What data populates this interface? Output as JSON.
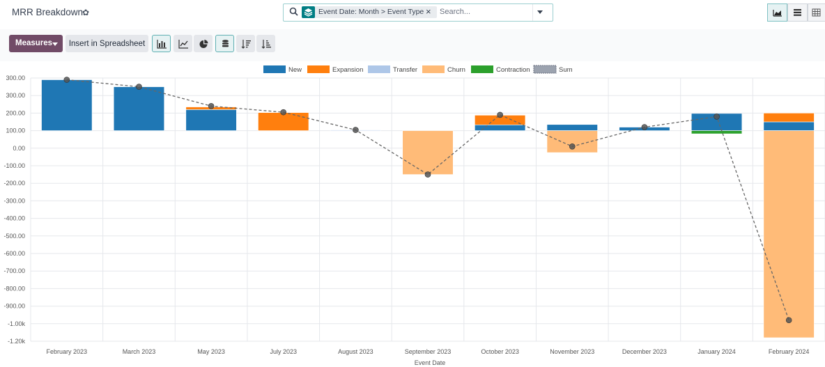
{
  "header": {
    "title": "MRR Breakdown",
    "gear_icon": "gear-icon"
  },
  "search": {
    "facet_label": "Event Date: Month > Event Type",
    "placeholder": "Search...",
    "close_glyph": "×"
  },
  "views": [
    "graph-view-icon",
    "list-view-icon",
    "pivot-view-icon"
  ],
  "controls": {
    "measures_label": "Measures",
    "insert_label": "Insert in Spreadsheet"
  },
  "colors": {
    "new": "#1f77b4",
    "expansion": "#ff7f0e",
    "transfer": "#aec7e8",
    "churn": "#ffbb78",
    "contraction": "#2ca02c",
    "sum": "#666666",
    "accent": "#714b67",
    "teal": "#017e84"
  },
  "chart_data": {
    "type": "bar",
    "stacked": true,
    "xlabel": "Event Date",
    "ylabel": "",
    "ylim": [
      -1200,
      300
    ],
    "y_ticks": [
      300,
      200,
      100,
      0,
      -100,
      -200,
      -300,
      -400,
      -500,
      -600,
      -700,
      -800,
      -900,
      -1000,
      -1100,
      -1200
    ],
    "y_tick_labels": [
      "300.00",
      "300.00",
      "200.00",
      "100.00",
      "0.00",
      "-100.00",
      "-200.00",
      "-300.00",
      "-400.00",
      "-500.00",
      "-600.00",
      "-700.00",
      "-800.00",
      "-900.00",
      "-1.00k",
      "-1.20k"
    ],
    "grid": true,
    "legend_position": "top-center",
    "categories": [
      "February 2023",
      "March 2023",
      "May 2023",
      "July 2023",
      "August 2023",
      "September 2023",
      "October 2023",
      "November 2023",
      "December 2023",
      "January 2024",
      "February 2024"
    ],
    "series": [
      {
        "name": "New",
        "values": [
          290,
          250,
          120,
          0,
          0,
          0,
          33,
          35,
          20,
          98,
          50
        ]
      },
      {
        "name": "Expansion",
        "values": [
          0,
          0,
          15,
          103,
          0,
          0,
          55,
          0,
          0,
          0,
          50
        ]
      },
      {
        "name": "Transfer",
        "values": [
          0,
          0,
          0,
          0,
          4,
          0,
          0,
          0,
          0,
          0,
          0
        ]
      },
      {
        "name": "Churn",
        "values": [
          0,
          0,
          0,
          0,
          0,
          -250,
          0,
          -125,
          0,
          0,
          -1180
        ]
      },
      {
        "name": "Contraction",
        "values": [
          0,
          0,
          0,
          0,
          0,
          0,
          0,
          0,
          0,
          -18,
          0
        ]
      },
      {
        "name": "Sum",
        "type": "line",
        "dashed": true,
        "values": [
          290,
          250,
          140,
          105,
          4,
          -250,
          90,
          -90,
          20,
          80,
          -1080
        ]
      }
    ]
  }
}
